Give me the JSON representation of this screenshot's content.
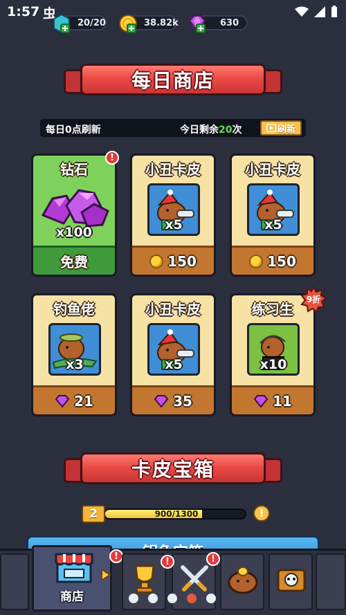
{
  "status_bar": {
    "time": "1:57",
    "app_glyph": "虫"
  },
  "resources": [
    {
      "name": "energy",
      "value": "20/20",
      "icon": "energy-icon"
    },
    {
      "name": "coins",
      "value": "38.82k",
      "icon": "coin-icon"
    },
    {
      "name": "gems",
      "value": "630",
      "icon": "gem-icon"
    }
  ],
  "daily_shop": {
    "title": "每日商店",
    "refresh_note": "每日0点刷新",
    "remaining_prefix": "今日剩余",
    "remaining_count": "20",
    "remaining_suffix": "次",
    "refresh_button": "刷新"
  },
  "items": [
    {
      "title": "钻石",
      "qty": "x100",
      "price": "免费",
      "currency": "none",
      "art": "gem-pile",
      "alert": "!"
    },
    {
      "title": "小丑卡皮",
      "qty": "x5",
      "price": "150",
      "currency": "coin",
      "art": "clown-capybara"
    },
    {
      "title": "小丑卡皮",
      "qty": "x5",
      "price": "150",
      "currency": "coin",
      "art": "clown-capybara"
    },
    {
      "title": "钓鱼佬",
      "qty": "x3",
      "price": "21",
      "currency": "gem",
      "art": "fisher-capybara"
    },
    {
      "title": "小丑卡皮",
      "qty": "x5",
      "price": "35",
      "currency": "gem",
      "art": "clown-capybara"
    },
    {
      "title": "练习生",
      "qty": "x10",
      "price": "11",
      "currency": "gem",
      "art": "trainee-capybara",
      "discount": "9折"
    }
  ],
  "skin_chest": {
    "title": "卡皮宝箱",
    "level": "2",
    "progress_text": "900/1300",
    "progress_current": 900,
    "progress_max": 1300,
    "hint": "!",
    "next_title_partial": "钥鱼宝箱"
  },
  "nav": {
    "active_label": "商店",
    "tabs": [
      "shop",
      "trophy",
      "battle",
      "capybara",
      "skull-chest"
    ],
    "page_dots": 5,
    "active_dot": 3
  },
  "colors": {
    "background": "#2b2e3d",
    "banner_red": "#ea4b45",
    "card_cream": "#f7e2a6",
    "price_brown": "#c3762f",
    "free_green": "#3e9a3a",
    "accent_green": "#62e04b"
  }
}
